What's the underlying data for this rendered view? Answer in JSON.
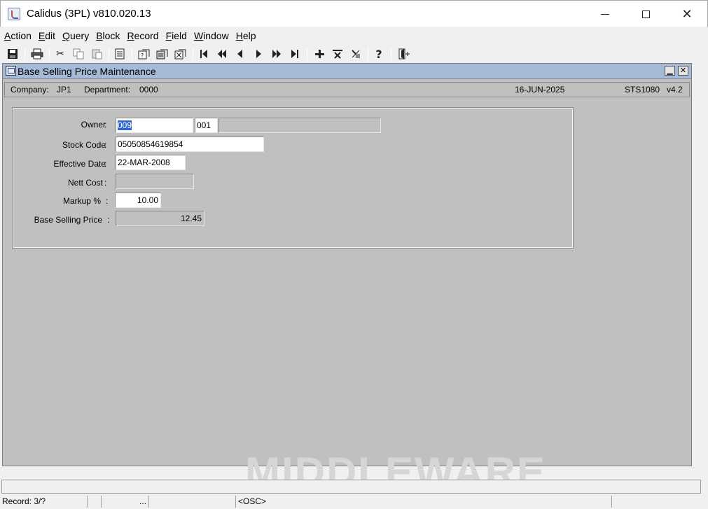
{
  "window": {
    "title": "Calidus (3PL) v810.020.13",
    "min_glyph": "—",
    "max_glyph": "☐",
    "close_glyph": "✕"
  },
  "menu": [
    "Action",
    "Edit",
    "Query",
    "Block",
    "Record",
    "Field",
    "Window",
    "Help"
  ],
  "toolbar": {
    "icons": [
      "save-icon",
      "print-icon",
      "cut-icon",
      "copy-icon",
      "paste-icon",
      "list-icon",
      "enter-query-icon",
      "execute-query-icon",
      "cancel-query-icon",
      "first-record-icon",
      "previous-block-icon",
      "previous-record-icon",
      "next-record-icon",
      "next-block-icon",
      "last-record-icon",
      "insert-record-icon",
      "delete-record-icon",
      "clear-record-icon",
      "help-icon",
      "exit-icon"
    ]
  },
  "form": {
    "title": "Base Selling Price Maintenance",
    "header": {
      "company_label": "Company:",
      "company_value": "JP1",
      "department_label": "Department:",
      "department_value": "0000",
      "date": "16-JUN-2025",
      "screen_code": "STS1080",
      "version": "v4.2"
    },
    "fields": {
      "owner_label": "Owner",
      "owner_value": "009",
      "owner_site_value": "001",
      "owner_name_value": "",
      "stock_code_label": "Stock Code",
      "stock_code_value": "05050854619854",
      "effective_date_label": "Effective Date",
      "effective_date_value": "22-MAR-2008",
      "nett_cost_label": "Nett Cost",
      "nett_cost_value": "",
      "markup_label": "Markup %",
      "markup_value": "10.00",
      "base_price_label": "Base Selling Price",
      "base_price_value": "12.45",
      "colon": ":"
    }
  },
  "watermark": "MIDDLEWARE",
  "status": {
    "record": "Record: 3/?",
    "ellipsis": "...",
    "mode": "<OSC>"
  }
}
